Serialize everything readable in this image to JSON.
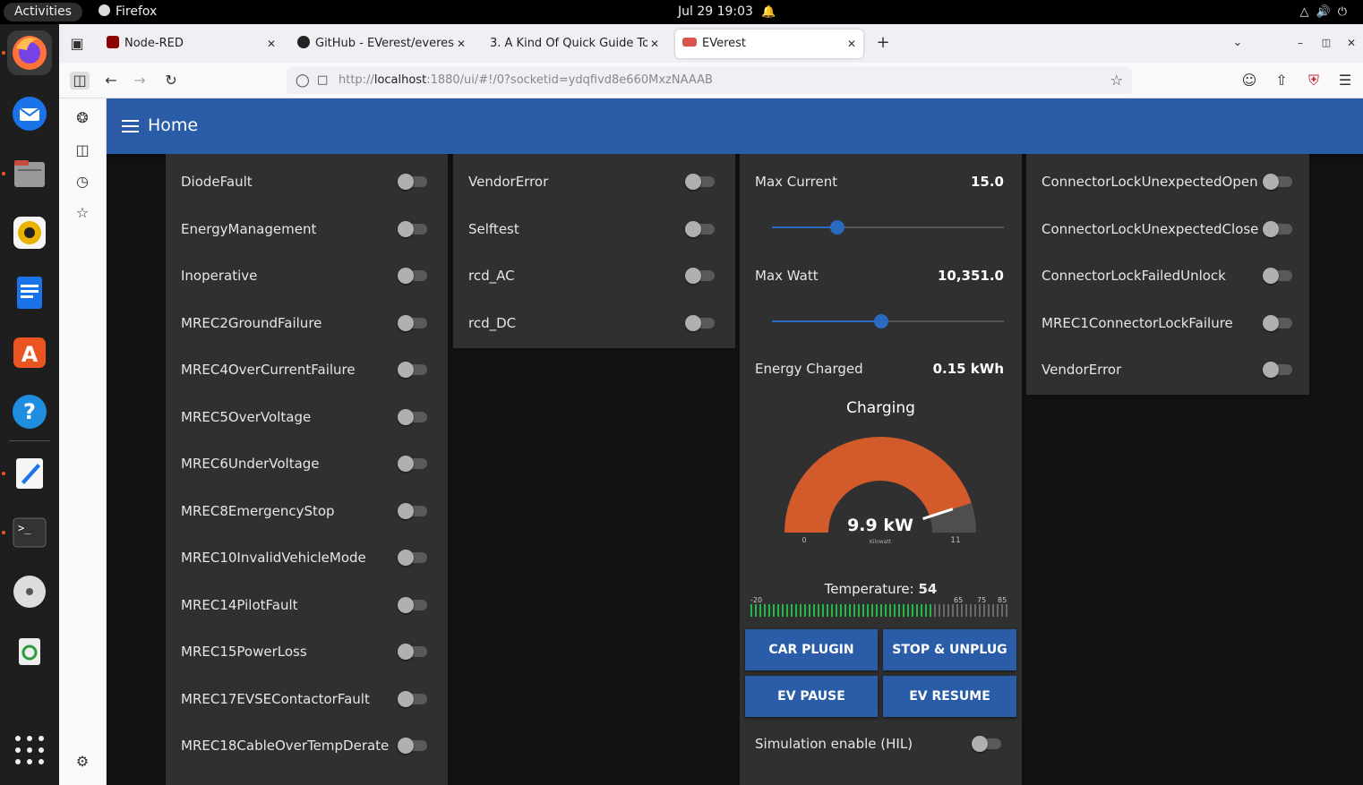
{
  "topbar": {
    "activities": "Activities",
    "app": "Firefox",
    "clock": "Jul 29  19:03"
  },
  "dock": {
    "items": [
      "firefox-icon",
      "thunderbird-icon",
      "files-icon",
      "rhythmbox-icon",
      "writer-icon",
      "software-icon",
      "help-icon",
      "text-editor-icon",
      "terminal-icon",
      "disc-icon",
      "trash-icon"
    ]
  },
  "browser": {
    "tabs": [
      {
        "label": "Node-RED"
      },
      {
        "label": "GitHub - EVerest/everest"
      },
      {
        "label": "3. A Kind Of Quick Guide To"
      },
      {
        "label": "EVerest"
      }
    ],
    "url_prefix": "http://",
    "url_host": "localhost",
    "url_rest": ":1880/ui/#!/0?socketid=ydqfivd8e660MxzNAAAB"
  },
  "page": {
    "title": "Home",
    "error_col1": [
      "DiodeFault",
      "EnergyManagement",
      "Inoperative",
      "MREC2GroundFailure",
      "MREC4OverCurrentFailure",
      "MREC5OverVoltage",
      "MREC6UnderVoltage",
      "MREC8EmergencyStop",
      "MREC10InvalidVehicleMode",
      "MREC14PilotFault",
      "MREC15PowerLoss",
      "MREC17EVSEContactorFault",
      "MREC18CableOverTempDerate"
    ],
    "error_col2": [
      "VendorError",
      "Selftest",
      "rcd_AC",
      "rcd_DC"
    ],
    "error_col4": [
      "ConnectorLockUnexpectedOpen",
      "ConnectorLockUnexpectedClose",
      "ConnectorLockFailedUnlock",
      "MREC1ConnectorLockFailure",
      "VendorError"
    ],
    "control": {
      "max_current_label": "Max Current",
      "max_current_value": "15.0",
      "max_current_fraction": 0.28,
      "max_watt_label": "Max Watt",
      "max_watt_value": "10,351.0",
      "max_watt_fraction": 0.47,
      "energy_label": "Energy Charged",
      "energy_value": "0.15 kWh",
      "status": "Charging",
      "gauge_value": "9.9 kW",
      "gauge_value_num": 9.9,
      "gauge_unit": "Kilowatt",
      "gauge_min": "0",
      "gauge_max": "11",
      "gauge_max_num": 11,
      "gauge_color": "#d35a2a",
      "temp_label": "Temperature:",
      "temp_value": "54",
      "temp_value_num": 54,
      "temp_min": "-20",
      "temp_min_num": -20,
      "temp_ticks": [
        "65",
        "75",
        "85"
      ],
      "temp_max_num": 85,
      "btn_plugin": "CAR PLUGIN",
      "btn_stop": "STOP & UNPLUG",
      "btn_pause": "EV PAUSE",
      "btn_resume": "EV RESUME",
      "simulation_label": "Simulation enable (HIL)"
    }
  }
}
